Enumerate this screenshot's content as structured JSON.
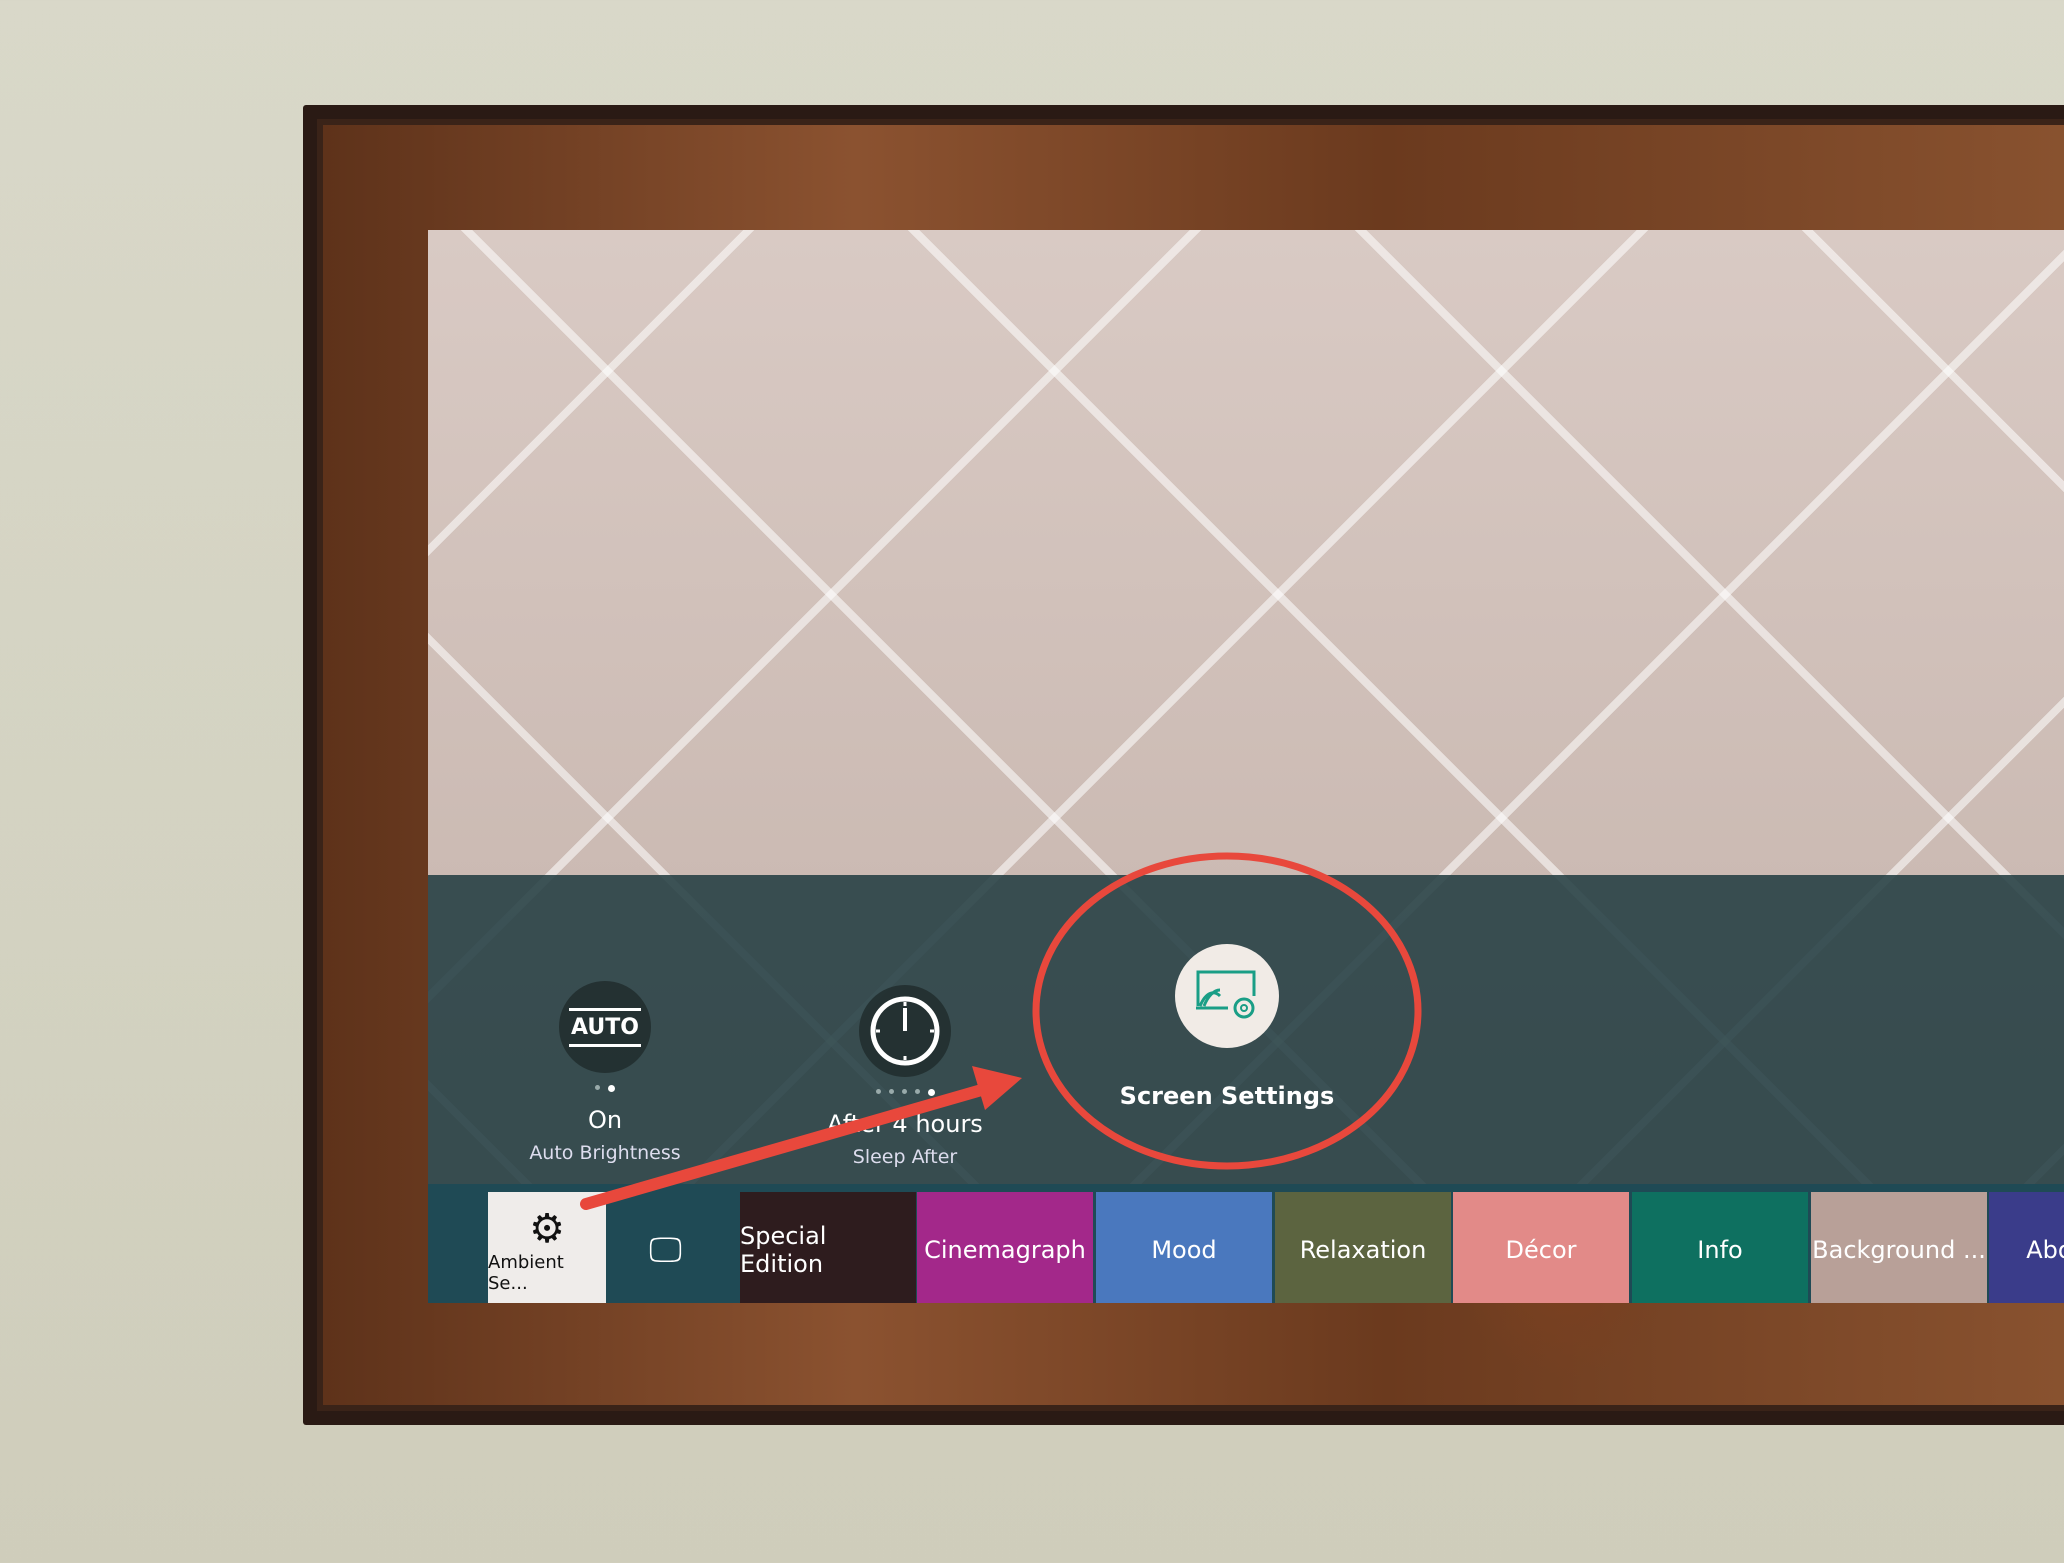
{
  "settings": {
    "brightness": {
      "value": "On",
      "label": "Auto Brightness",
      "icon": "AUTO",
      "steps": 2,
      "selected": 2
    },
    "sleep": {
      "value": "After 4 hours",
      "label": "Sleep After",
      "steps": 5,
      "selected": 5
    },
    "screen": {
      "label": "Screen Settings"
    }
  },
  "bar": {
    "ambient_label": "Ambient Se...",
    "tiles": [
      {
        "label": "Special Edition",
        "color": "#2e1c1e"
      },
      {
        "label": "Cinemagraph",
        "color": "#a3288a"
      },
      {
        "label": "Mood",
        "color": "#4a78be"
      },
      {
        "label": "Relaxation",
        "color": "#5c6440"
      },
      {
        "label": "Décor",
        "color": "#e28a88"
      },
      {
        "label": "Info",
        "color": "#0e7060"
      },
      {
        "label": "Background ...",
        "color": "#b8a098"
      },
      {
        "label": "About ...",
        "color": "#3a3c8a"
      }
    ]
  },
  "annotation_color": "#e8483c"
}
